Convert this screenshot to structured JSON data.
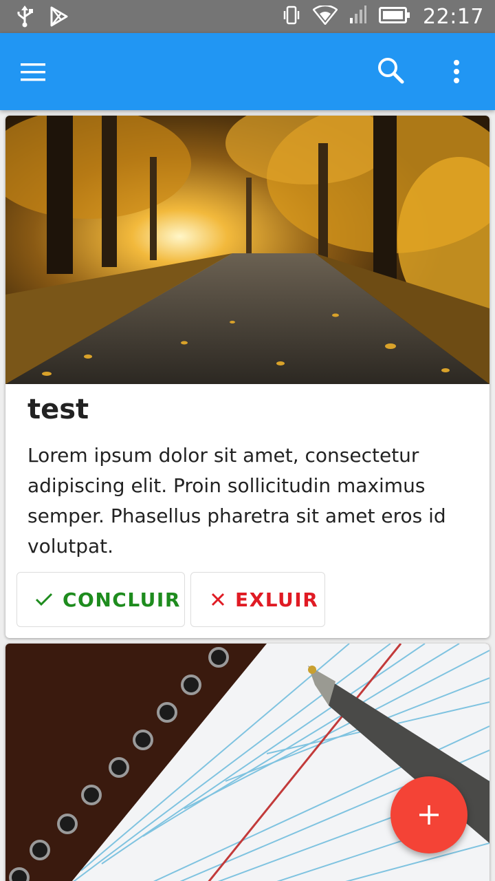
{
  "status_bar": {
    "time": "22:17",
    "icons": [
      "usb-icon",
      "play-store-icon",
      "vibrate-icon",
      "wifi-icon",
      "signal-icon",
      "battery-icon"
    ]
  },
  "app_bar": {
    "color": "#2196f3",
    "icons": [
      "menu-icon",
      "search-icon",
      "more-vert-icon"
    ]
  },
  "cards": [
    {
      "image": "autumn-road-image",
      "title": "test",
      "body": "Lorem ipsum dolor sit amet, consectetur adipiscing elit. Proin sollicitudin maximus semper. Phasellus pharetra sit amet eros id volutpat.",
      "done_label": "CONCLUIR",
      "delete_label": "EXLUIR"
    },
    {
      "image": "notebook-pen-image"
    }
  ],
  "fab": {
    "icon": "plus-icon",
    "color": "#f44336"
  },
  "colors": {
    "done": "#1e8c1e",
    "delete": "#e01b24"
  }
}
